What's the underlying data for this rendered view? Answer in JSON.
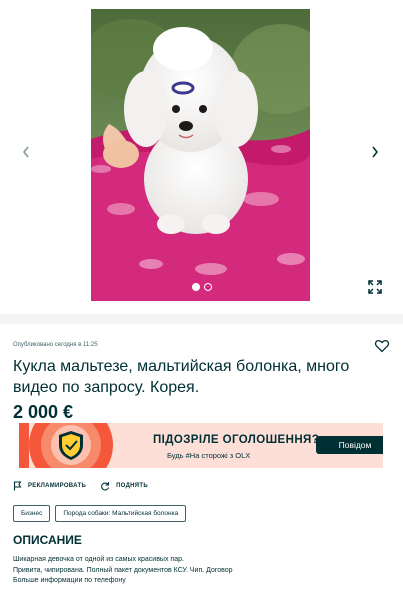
{
  "gallery": {
    "image_alt": "Maltese puppy on pink blanket",
    "image_count": 2,
    "active_index": 1
  },
  "listing": {
    "published": "Опубликовано сегодня в 11:25",
    "title": "Кукла мальтезе, мальтийская болонка, много видео по запросу. Корея.",
    "price": "2 000 €"
  },
  "banner": {
    "title": "ПІДОЗРІЛЕ ОГОЛОШЕННЯ?",
    "subtitle": "Будь #На сторожі з OLX",
    "button": "Повідом",
    "colors": {
      "background": "#fddfd8",
      "accent": "#f4573a",
      "button": "#002f34"
    }
  },
  "actions": {
    "promote": "РЕКЛАМИРОВАТЬ",
    "refresh": "ПОДНЯТЬ"
  },
  "tags": [
    "Бизнес",
    "Порода собаки: Мальтийская болонка"
  ],
  "description": {
    "heading": "ОПИСАНИЕ",
    "lines": [
      "Шикарная девочка от одной из самых красивых пар.",
      "Привита, чипирована. Полный пакет документов КСУ. Чип. Договор",
      "Больше информации по телефону"
    ]
  },
  "icons": [
    "chevron-left-icon",
    "chevron-right-icon",
    "expand-icon",
    "heart-icon",
    "shield-check-icon",
    "flag-icon",
    "refresh-icon"
  ],
  "colors": {
    "text": "#002f34",
    "muted": "#406367",
    "page_bg": "#f2f4f5"
  }
}
